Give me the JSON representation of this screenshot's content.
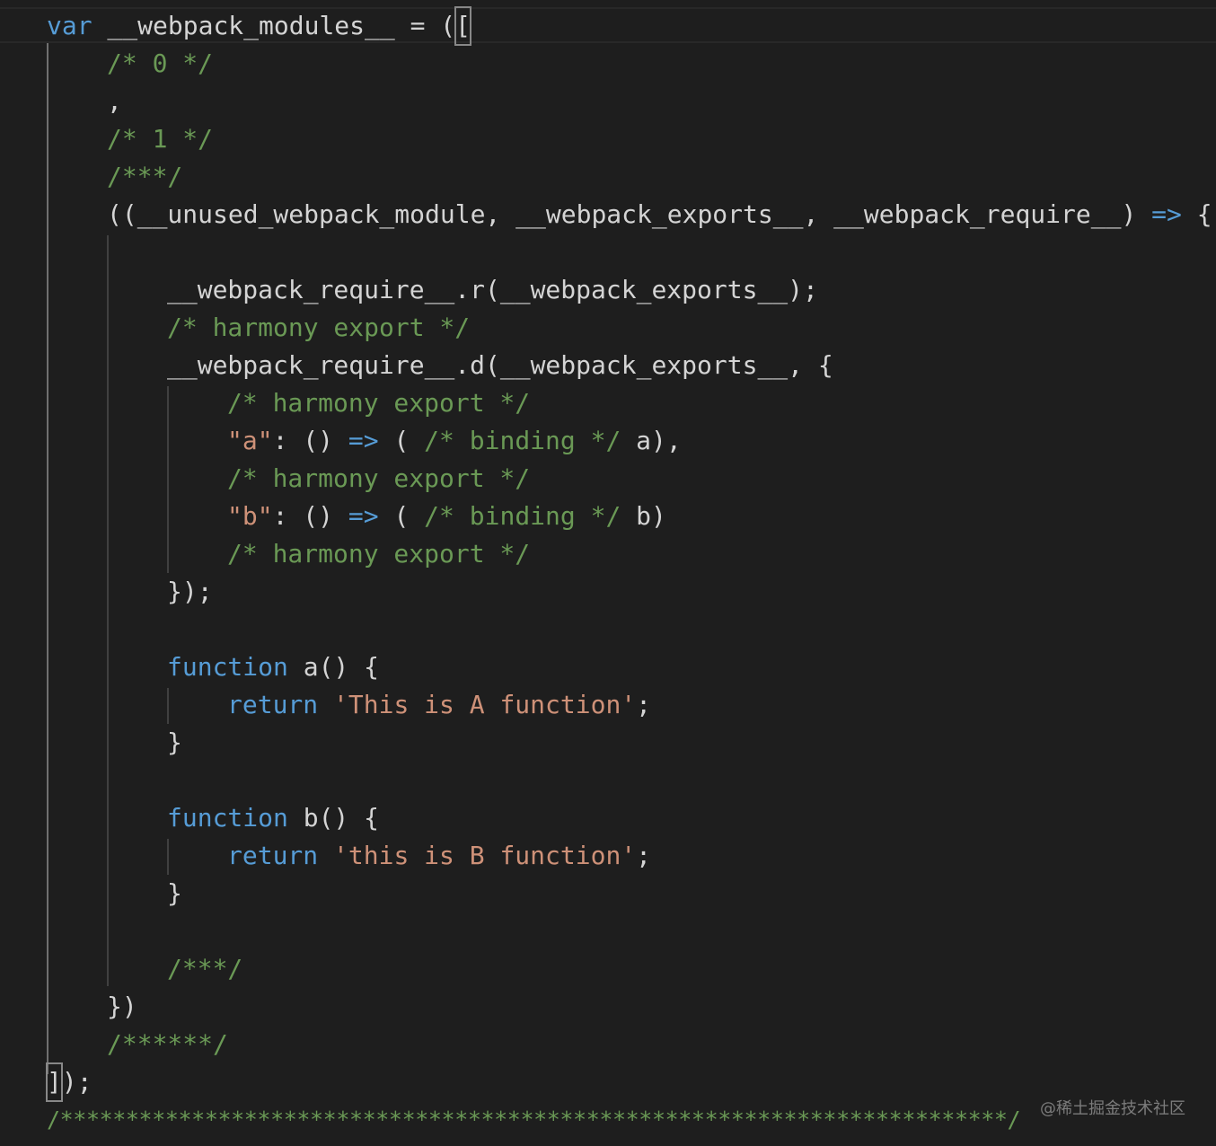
{
  "editor": {
    "lines": [
      {
        "id": "l1",
        "tokens": [
          [
            "kw",
            "var"
          ],
          [
            "ft",
            " __webpack_modules__ = ("
          ],
          [
            "cursor",
            "["
          ]
        ]
      },
      {
        "id": "l2",
        "tokens": [
          [
            "cm",
            "/* 0 */"
          ]
        ]
      },
      {
        "id": "l3",
        "tokens": [
          [
            "ft",
            ","
          ]
        ]
      },
      {
        "id": "l4",
        "tokens": [
          [
            "cm",
            "/* 1 */"
          ]
        ]
      },
      {
        "id": "l5",
        "tokens": [
          [
            "cm",
            "/***/"
          ]
        ]
      },
      {
        "id": "l6",
        "tokens": [
          [
            "ft",
            "((__unused_webpack_module, __webpack_exports__, __webpack_require__) "
          ],
          [
            "op",
            "=>"
          ],
          [
            "ft",
            " {"
          ]
        ]
      },
      {
        "id": "l7",
        "tokens": [
          [
            "ft",
            "__webpack_require__.r(__webpack_exports__);"
          ]
        ]
      },
      {
        "id": "l8",
        "tokens": [
          [
            "cm",
            "/* harmony export */"
          ]
        ]
      },
      {
        "id": "l9",
        "tokens": [
          [
            "ft",
            "__webpack_require__.d(__webpack_exports__, {"
          ]
        ]
      },
      {
        "id": "l10",
        "tokens": [
          [
            "cm",
            "/* harmony export */"
          ]
        ]
      },
      {
        "id": "l11",
        "tokens": [
          [
            "st",
            "\"a\""
          ],
          [
            "ft",
            ": () "
          ],
          [
            "op",
            "=>"
          ],
          [
            "ft",
            " ( "
          ],
          [
            "cm",
            "/* binding */"
          ],
          [
            "ft",
            " a),"
          ]
        ]
      },
      {
        "id": "l12",
        "tokens": [
          [
            "cm",
            "/* harmony export */"
          ]
        ]
      },
      {
        "id": "l13",
        "tokens": [
          [
            "st",
            "\"b\""
          ],
          [
            "ft",
            ": () "
          ],
          [
            "op",
            "=>"
          ],
          [
            "ft",
            " ( "
          ],
          [
            "cm",
            "/* binding */"
          ],
          [
            "ft",
            " b)"
          ]
        ]
      },
      {
        "id": "l14",
        "tokens": [
          [
            "cm",
            "/* harmony export */"
          ]
        ]
      },
      {
        "id": "l15",
        "tokens": [
          [
            "ft",
            "});"
          ]
        ]
      },
      {
        "id": "l16",
        "tokens": [
          [
            "kw",
            "function"
          ],
          [
            "ft",
            " a() {"
          ]
        ]
      },
      {
        "id": "l17",
        "tokens": [
          [
            "kw",
            "return"
          ],
          [
            "ft",
            " "
          ],
          [
            "st",
            "'This is A function'"
          ],
          [
            "ft",
            ";"
          ]
        ]
      },
      {
        "id": "l18",
        "tokens": [
          [
            "ft",
            "}"
          ]
        ]
      },
      {
        "id": "l19",
        "tokens": [
          [
            "kw",
            "function"
          ],
          [
            "ft",
            " b() {"
          ]
        ]
      },
      {
        "id": "l20",
        "tokens": [
          [
            "kw",
            "return"
          ],
          [
            "ft",
            " "
          ],
          [
            "st",
            "'this is B function'"
          ],
          [
            "ft",
            ";"
          ]
        ]
      },
      {
        "id": "l21",
        "tokens": [
          [
            "ft",
            "}"
          ]
        ]
      },
      {
        "id": "l22",
        "tokens": [
          [
            "cm",
            "/***/"
          ]
        ]
      },
      {
        "id": "l23",
        "tokens": [
          [
            "ft",
            "})"
          ]
        ]
      },
      {
        "id": "l24",
        "tokens": [
          [
            "cm",
            "/******/"
          ]
        ]
      },
      {
        "id": "l25",
        "tokens": [
          [
            "cursor",
            "]"
          ],
          [
            "ft",
            ");"
          ]
        ]
      },
      {
        "id": "l26",
        "tokens": [
          [
            "cm",
            "/************************************************************************/"
          ]
        ]
      }
    ]
  },
  "watermark": "@稀土掘金技术社区",
  "colors": {
    "background": "#1e1e1e",
    "keyword": "#569cd6",
    "comment": "#6a9955",
    "string": "#ce9178",
    "text": "#d4d4d4"
  }
}
